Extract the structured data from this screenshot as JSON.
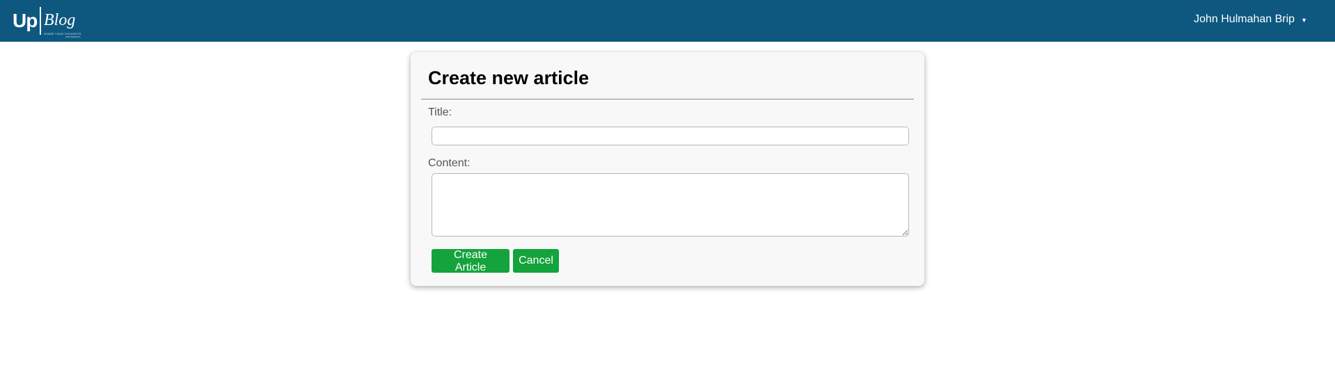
{
  "header": {
    "logo": {
      "brand_main": "Up",
      "brand_sub": "Blog",
      "tagline": "SHARE YOUR THOUGHTS",
      "tagline2": "AND INSIGHTS"
    },
    "user": {
      "name": "John Hulmahan Brip",
      "caret": "▼"
    },
    "colors": {
      "navbar_bg": "#0e5880"
    }
  },
  "form": {
    "title": "Create new article",
    "title_label": "Title:",
    "title_value": "",
    "content_label": "Content:",
    "content_value": "",
    "create_button": "Create Article",
    "cancel_button": "Cancel",
    "colors": {
      "button_bg": "#14a33c"
    }
  }
}
